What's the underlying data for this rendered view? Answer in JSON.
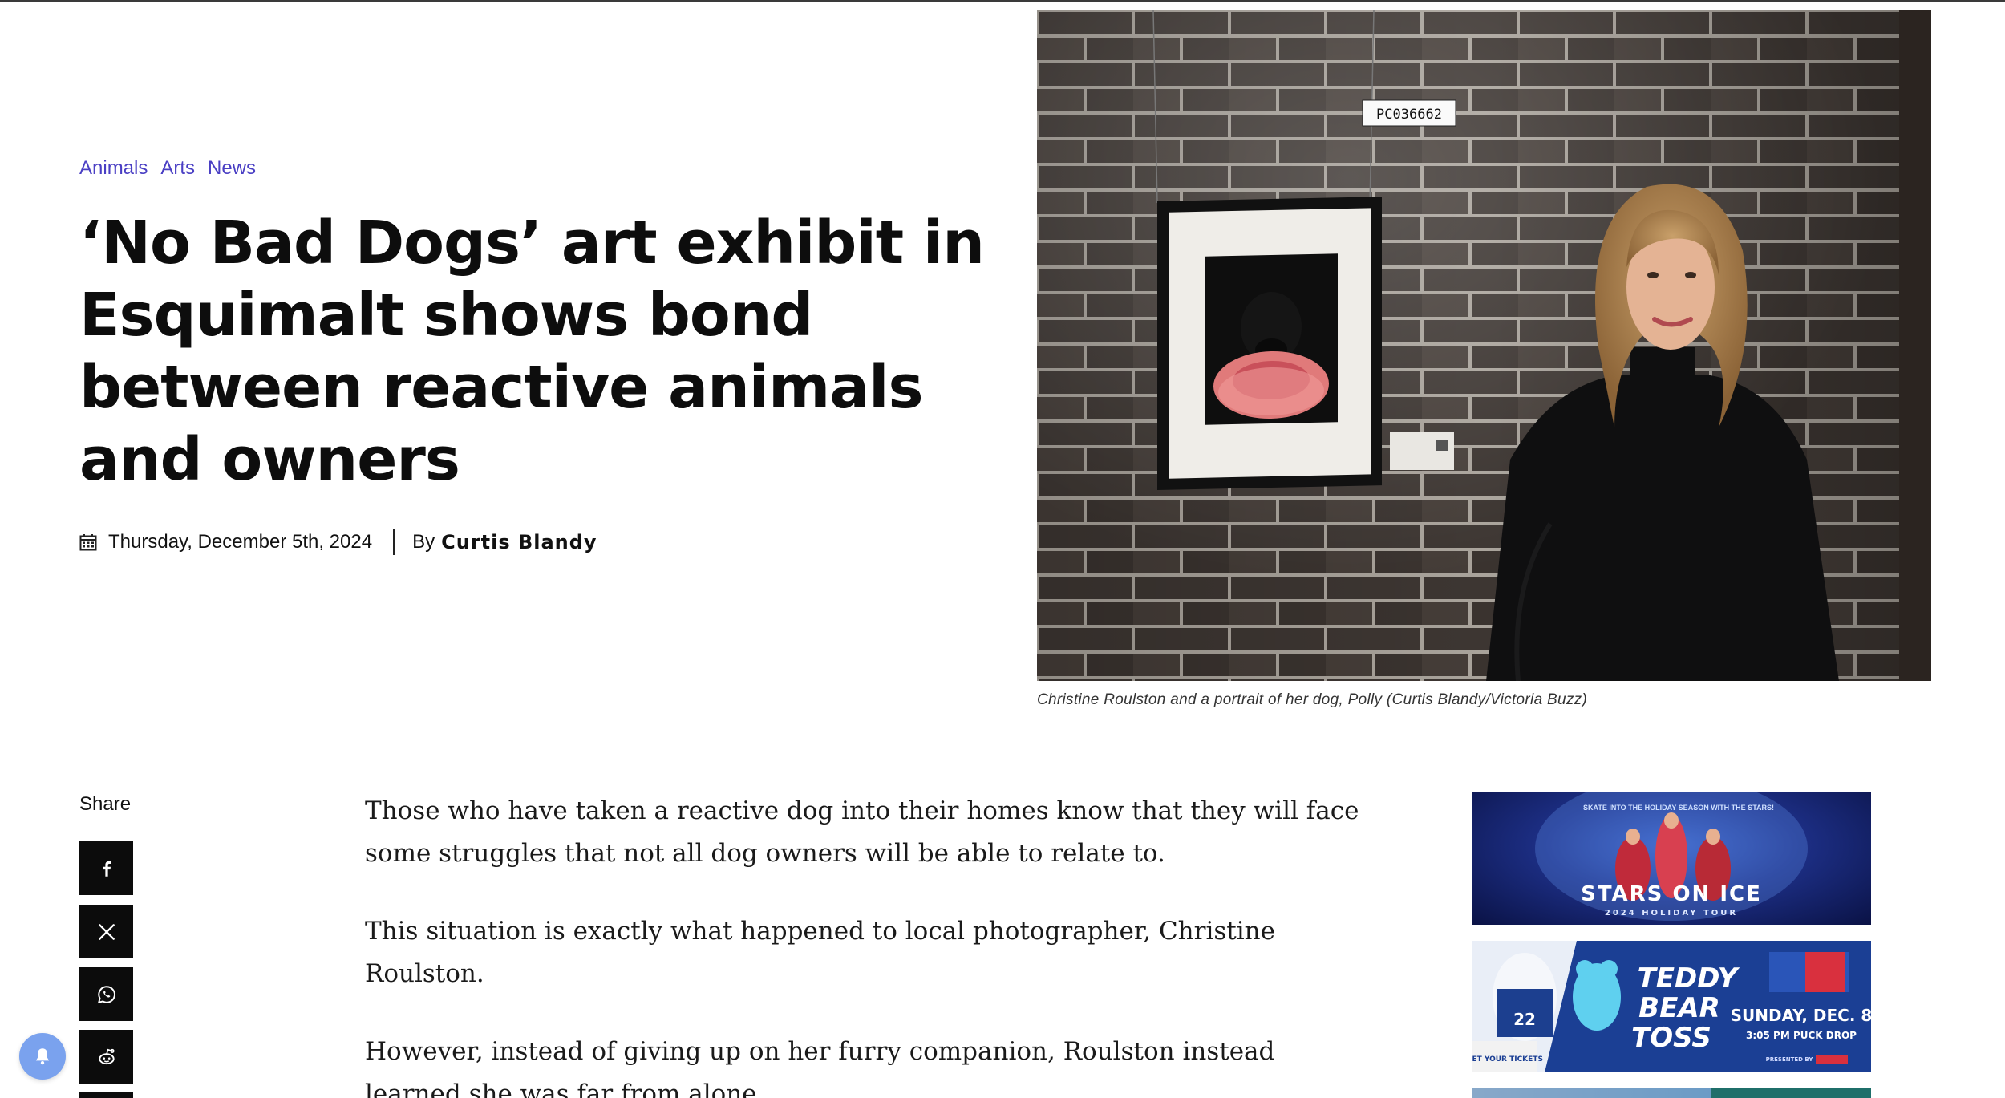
{
  "categories": [
    "Animals",
    "Arts",
    "News"
  ],
  "article": {
    "title": "‘No Bad Dogs’ art exhibit in Esquimalt shows bond between reactive animals and owners",
    "date": "Thursday, December 5th, 2024",
    "by_label": "By",
    "author": "Curtis Blandy"
  },
  "hero": {
    "tag": "PC036662",
    "caption": "Christine Roulston and a portrait of her dog, Polly (Curtis Blandy/Victoria Buzz)"
  },
  "share": {
    "label": "Share",
    "buttons": [
      "facebook-icon",
      "x-icon",
      "whatsapp-icon",
      "reddit-icon"
    ]
  },
  "body": {
    "paragraphs": [
      "Those who have taken a reactive dog into their homes know that they will face some struggles that not all dog owners will be able to relate to.",
      "This situation is exactly what happened to local photographer, Christine Roulston.",
      "However, instead of giving up on her furry companion, Roulston instead learned she was far from alone."
    ]
  },
  "ads": {
    "stars_on_ice": {
      "tagline": "SKATE INTO THE HOLIDAY SEASON WITH THE STARS!",
      "brand": "STARS ON ICE",
      "sub": "2024 HOLIDAY TOUR"
    },
    "teddy_bear_toss": {
      "title_line1": "TEDDY",
      "title_line2": "BEAR",
      "title_line3": "TOSS",
      "date": "SUNDAY, DEC. 8",
      "time": "3:05 PM PUCK DROP",
      "cta": "GET YOUR TICKETS",
      "sponsor": "PRESENTED BY",
      "jersey": "22"
    }
  },
  "colors": {
    "category": "#4a3fc4",
    "share_bg": "#0c0c0c",
    "bell": "#7aa2ee"
  }
}
